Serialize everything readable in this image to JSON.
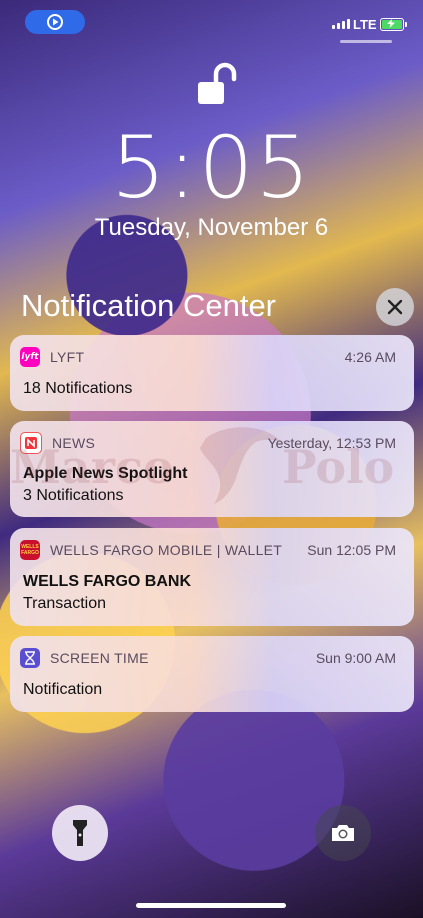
{
  "status_bar": {
    "carrier": "LTE"
  },
  "lock_screen": {
    "time": "5:05",
    "date": "Tuesday, November 6"
  },
  "notification_center": {
    "title": "Notification Center",
    "notifications": [
      {
        "app": "LYFT",
        "time": "4:26 AM",
        "title": "",
        "body": "18 Notifications",
        "icon": "lyft-icon",
        "icon_label": "lyft",
        "color": "#ff00bf"
      },
      {
        "app": "NEWS",
        "time": "Yesterday, 12:53 PM",
        "title": "Apple News Spotlight",
        "body": "3 Notifications",
        "icon": "news-icon",
        "color": "#f1373d"
      },
      {
        "app": "WELLS FARGO MOBILE | WALLET",
        "time": "Sun 12:05 PM",
        "title": "WELLS FARGO BANK",
        "body": "Transaction",
        "icon": "wells-fargo-icon",
        "icon_label": "WELLS FARGO",
        "color": "#c8102e"
      },
      {
        "app": "SCREEN TIME",
        "time": "Sun 9:00 AM",
        "title": "",
        "body": "Notification",
        "icon": "hourglass-icon",
        "color": "#5b4fd1"
      }
    ]
  },
  "watermark": {
    "left": "Marco",
    "right": "Polo"
  }
}
